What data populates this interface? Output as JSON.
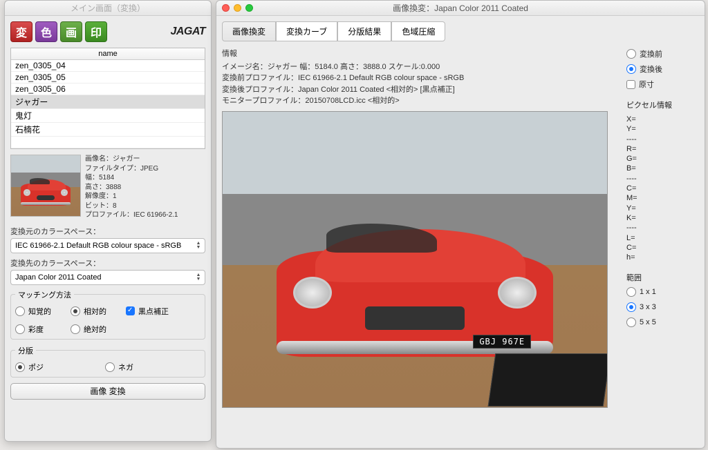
{
  "left": {
    "title": "メイン画面（変換）",
    "toolbar": {
      "btn1": "変",
      "btn2": "色",
      "btn3": "画",
      "btn4": "印"
    },
    "logo": "JAGAT",
    "list_header": "name",
    "list": [
      "zen_0305_04",
      "zen_0305_05",
      "zen_0305_06",
      "ジャガー",
      "鬼灯",
      "石楠花"
    ],
    "info": {
      "l1": "画像名：ジャガー",
      "l2": "ファイルタイプ：JPEG",
      "l3": "幅：5184",
      "l4": "高さ：3888",
      "l5": "解像度：1",
      "l6": "ビット：8",
      "l7": "プロファイル：IEC 61966-2.1"
    },
    "src_label": "変換元のカラースペース：",
    "src_value": "IEC 61966-2.1 Default RGB colour space - sRGB",
    "dst_label": "変換先のカラースペース：",
    "dst_value": "Japan Color 2011 Coated",
    "matching": {
      "legend": "マッチング方法",
      "perceptual": "知覚的",
      "relative": "相対的",
      "blackpoint": "黒点補正",
      "saturation": "彩度",
      "absolute": "絶対的"
    },
    "sep": {
      "legend": "分版",
      "positive": "ポジ",
      "negative": "ネガ"
    },
    "convert_btn": "画像 変換"
  },
  "right": {
    "title": "画像換変：Japan Color 2011 Coated",
    "tabs": {
      "t1": "画像換変",
      "t2": "変換カーブ",
      "t3": "分版結果",
      "t4": "色域圧縮"
    },
    "info": {
      "hd": "情報",
      "l1": "イメージ名：ジャガー 幅：5184.0 高さ：3888.0 スケール:0.000",
      "l2": "変換前プロファイル：IEC 61966-2.1 Default RGB colour space - sRGB",
      "l3": "変換後プロファイル：Japan Color 2011 Coated  <相対的> [黒点補正]",
      "l4": "モニタープロファイル：20150708LCD.icc  <相対的>"
    },
    "plate": "GBJ 967E",
    "view": {
      "before": "変換前",
      "after": "変換後",
      "actual": "原寸"
    },
    "pixel": {
      "hd": "ピクセル情報",
      "x": "X=",
      "y": "Y=",
      "s1": "----",
      "r": "R=",
      "g": "G=",
      "b": "B=",
      "s2": "----",
      "c": "C=",
      "m": "M=",
      "yk": "Y=",
      "k": "K=",
      "s3": "----",
      "l": "L=",
      "cc": "C=",
      "h": "h="
    },
    "range": {
      "hd": "範囲",
      "r1": "1 x 1",
      "r3": "3 x 3",
      "r5": "5 x 5"
    }
  }
}
